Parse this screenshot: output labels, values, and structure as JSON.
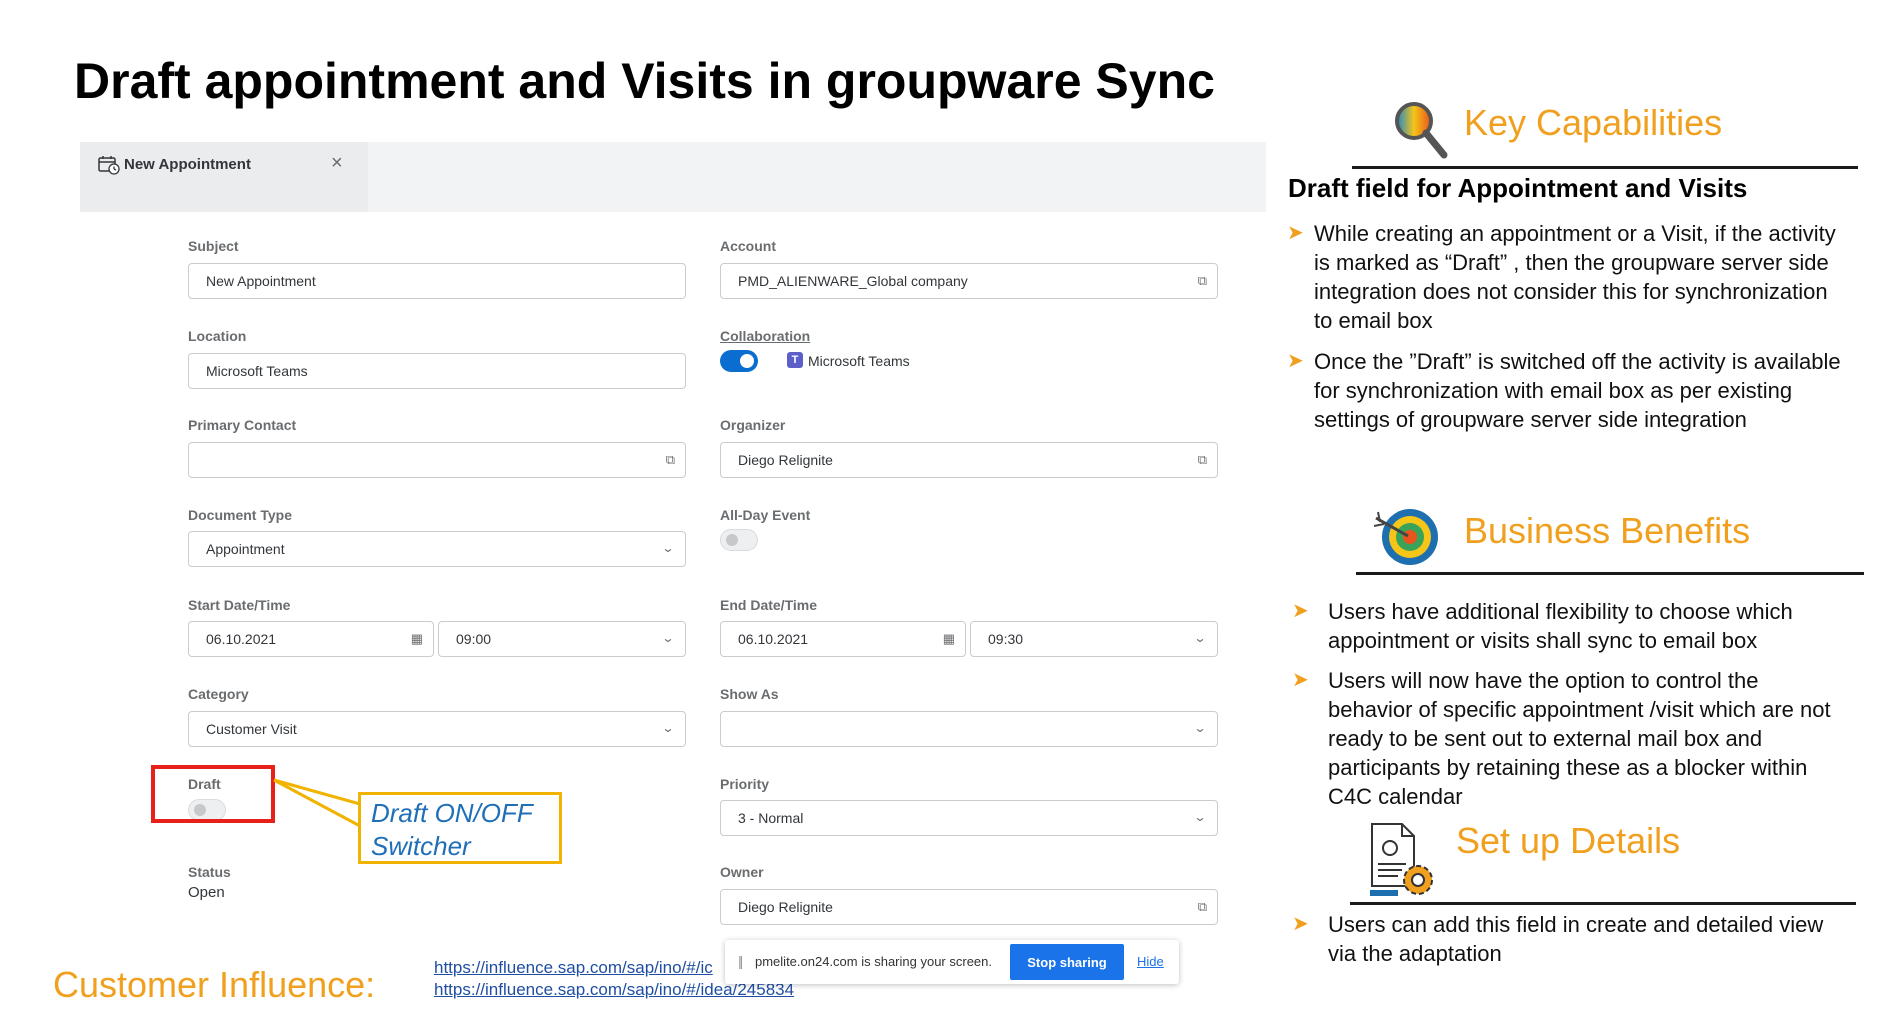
{
  "slide": {
    "title": "Draft appointment and Visits in groupware Sync"
  },
  "tab": {
    "label": "New Appointment",
    "close": "×"
  },
  "form": {
    "subject": {
      "label": "Subject",
      "value": "New Appointment"
    },
    "location": {
      "label": "Location",
      "value": "Microsoft Teams"
    },
    "primary_contact": {
      "label": "Primary Contact",
      "value": ""
    },
    "document_type": {
      "label": "Document Type",
      "value": "Appointment"
    },
    "start": {
      "label": "Start Date/Time",
      "date": "06.10.2021",
      "time": "09:00"
    },
    "category": {
      "label": "Category",
      "value": "Customer Visit"
    },
    "draft": {
      "label": "Draft",
      "on": false
    },
    "status": {
      "label": "Status",
      "value": "Open"
    },
    "account": {
      "label": "Account",
      "value": "PMD_ALIENWARE_Global company"
    },
    "collaboration": {
      "label": "Collaboration",
      "on": true,
      "service": "Microsoft Teams"
    },
    "organizer": {
      "label": "Organizer",
      "value": "Diego Relignite"
    },
    "all_day": {
      "label": "All-Day Event",
      "on": false
    },
    "end": {
      "label": "End Date/Time",
      "date": "06.10.2021",
      "time": "09:30"
    },
    "show_as": {
      "label": "Show As",
      "value": ""
    },
    "priority": {
      "label": "Priority",
      "value": "3 - Normal"
    },
    "owner": {
      "label": "Owner",
      "value": "Diego Relignite"
    }
  },
  "callout": {
    "line1": "Draft ON/OFF",
    "line2": "Switcher"
  },
  "share_bar": {
    "text": "pmelite.on24.com is sharing your screen.",
    "stop": "Stop sharing",
    "hide": "Hide"
  },
  "influence": {
    "label": "Customer Influence:",
    "link1": "https://influence.sap.com/sap/ino/#/ic",
    "link2": "https://influence.sap.com/sap/ino/#/idea/245834"
  },
  "key_capabilities": {
    "title": "Key Capabilities",
    "heading": "Draft field for Appointment and Visits",
    "bullets": [
      [
        "While creating an appointment or a Visit,  if the activity",
        "is marked as “Draft” , then the groupware server side",
        "integration does not consider this for synchronization",
        "to email box"
      ],
      [
        "Once the ”Draft” is switched off the activity is available",
        "for synchronization with email box as per existing",
        "settings of groupware server side integration"
      ]
    ]
  },
  "business_benefits": {
    "title": "Business Benefits",
    "bullets": [
      [
        "Users have additional flexibility to choose which",
        "appointment or visits shall sync to email box"
      ],
      [
        "Users will now have the option to control the",
        "behavior of specific appointment /visit which are not",
        "ready to be sent out to external mail box and",
        "participants  by retaining these as a blocker within",
        "C4C calendar"
      ]
    ]
  },
  "setup_details": {
    "title": "Set up Details",
    "bullets": [
      [
        "Users can add this field in create and detailed view",
        "via the adaptation"
      ]
    ]
  },
  "colors": {
    "accent_orange": "#f0a01e",
    "toggle_blue": "#0a6ed1",
    "highlight_red": "#e8201a",
    "callout_yellow": "#f0b400",
    "callout_text": "#1f6fb7"
  }
}
